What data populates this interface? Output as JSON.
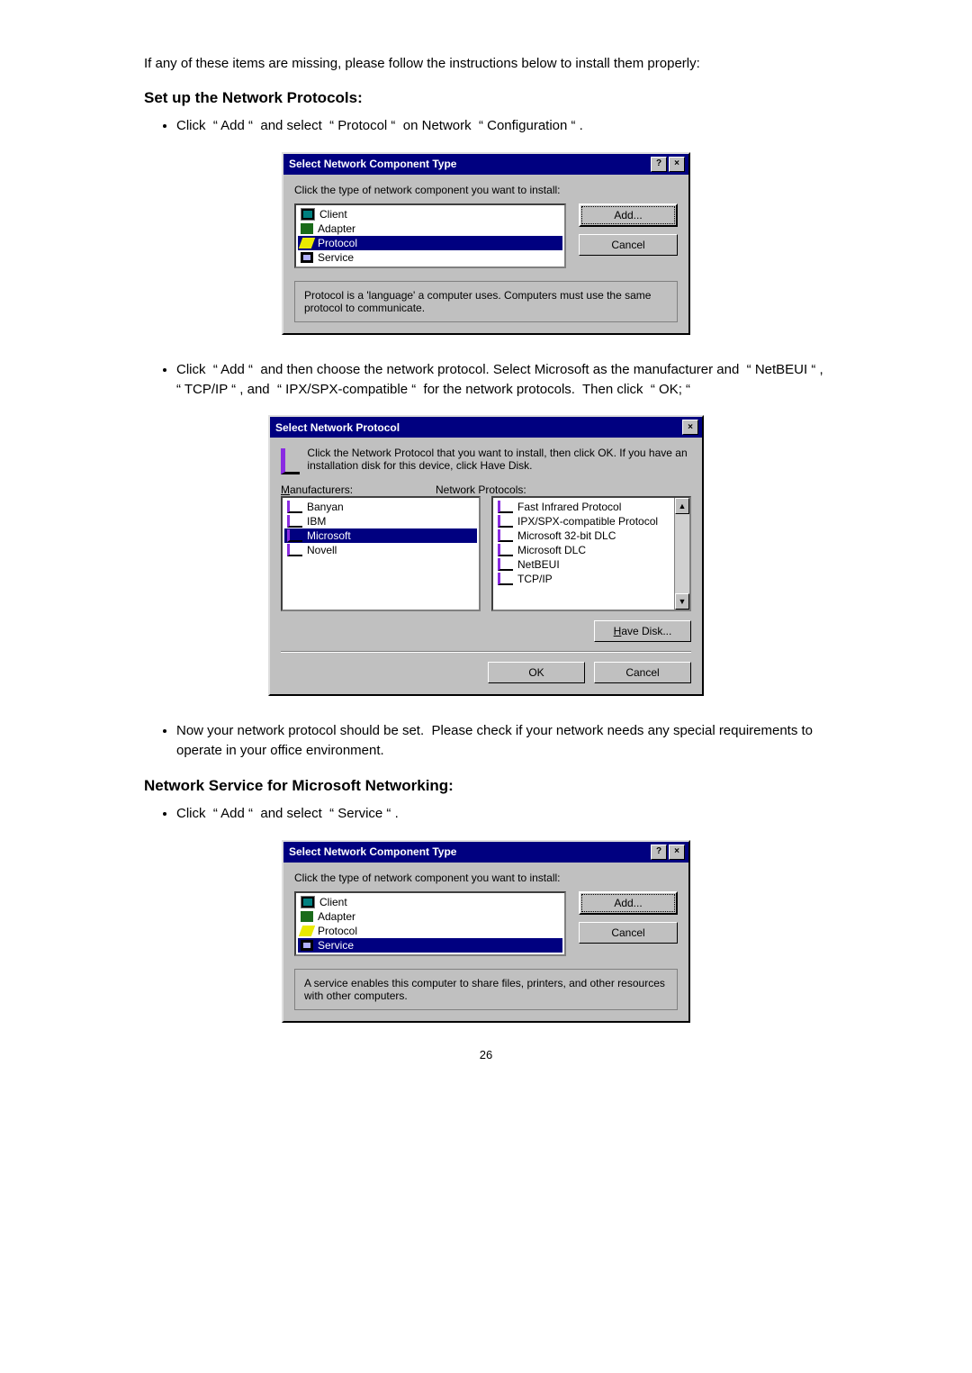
{
  "intro": "If any of these items are missing, please follow the instructions below to install them properly:",
  "h_setup": "Set up the Network Protocols:",
  "bullet1": "Click  “ Add “  and select  “ Protocol “  on Network  “ Configuration “ .",
  "bullet2": "Click  “ Add “  and then choose the network protocol. Select Microsoft as the manufacturer and  “ NetBEUI “ ,  “ TCP/IP “ , and  “ IPX/SPX-compatible “  for the network protocols.  Then click  “ OK; “",
  "bullet3": "Now your network protocol should be set.  Please check if your network needs any special requirements to operate in your office environment.",
  "h_service": "Network Service for Microsoft Networking:",
  "bullet4": "Click  “ Add “  and select  “ Service “ .",
  "pageNumber": "26",
  "dlg1": {
    "title": "Select Network Component Type",
    "prompt": "Click the type of network component you want to install:",
    "items": [
      "Client",
      "Adapter",
      "Protocol",
      "Service"
    ],
    "sel": 2,
    "add": "Add...",
    "cancel": "Cancel",
    "desc": "Protocol is a 'language' a computer uses. Computers must use the same protocol to communicate."
  },
  "dlg2": {
    "title": "Select Network Protocol",
    "prompt": "Click the Network Protocol that you want to install, then click OK. If you have an installation disk for this device, click Have Disk.",
    "manuLabel": "Manufacturers:",
    "protoLabel": "Network Protocols:",
    "manufacturers": [
      "Banyan",
      "IBM",
      "Microsoft",
      "Novell"
    ],
    "manuSel": 2,
    "protocols": [
      "Fast Infrared Protocol",
      "IPX/SPX-compatible Protocol",
      "Microsoft 32-bit DLC",
      "Microsoft DLC",
      "NetBEUI",
      "TCP/IP"
    ],
    "haveDisk": "Have Disk...",
    "ok": "OK",
    "cancel": "Cancel"
  },
  "dlg3": {
    "title": "Select Network Component Type",
    "prompt": "Click the type of network component you want to install:",
    "items": [
      "Client",
      "Adapter",
      "Protocol",
      "Service"
    ],
    "sel": 3,
    "add": "Add...",
    "cancel": "Cancel",
    "desc": "A service enables this computer to share files, printers, and other resources with other computers."
  }
}
